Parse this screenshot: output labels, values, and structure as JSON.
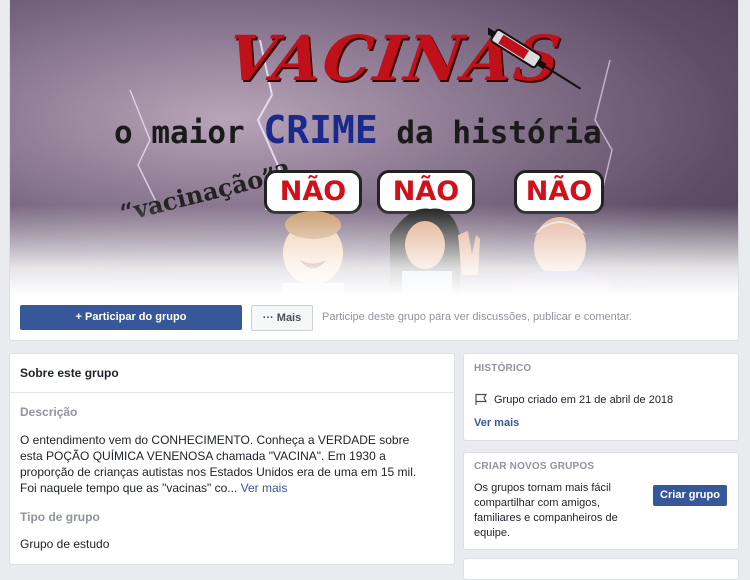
{
  "cover": {
    "title": "VACINAS",
    "subtitle_pre": "o maior ",
    "subtitle_crime": "CRIME",
    "subtitle_post": " da história",
    "tagline": "“vacinação”?",
    "bubbles": [
      "NÃO",
      "NÃO",
      "NÃO"
    ]
  },
  "actions": {
    "join_label": "Participar do grupo",
    "more_label": "Mais",
    "hint": "Participe deste grupo para ver discussões, publicar e comentar."
  },
  "about": {
    "title": "Sobre este grupo",
    "description_label": "Descrição",
    "description": "O entendimento vem do CONHECIMENTO. Conheça a VERDADE sobre esta POÇÃO QUÍMICA VENENOSA chamada \"VACINA\". Em 1930 a proporção de crianças autistas nos Estados Unidos era de uma em 15 mil. Foi naquele tempo que as \"vacinas\" co...",
    "see_more": "Ver mais",
    "type_label": "Tipo de grupo",
    "type_value": "Grupo de estudo"
  },
  "history": {
    "title": "HISTÓRICO",
    "created": "Grupo criado em 21 de abril de 2018",
    "see_more": "Ver mais"
  },
  "create_groups": {
    "title": "CRIAR NOVOS GRUPOS",
    "text": "Os grupos tornam mais fácil compartilhar com amigos, familiares e companheiros de equipe.",
    "button": "Criar grupo"
  },
  "colors": {
    "primary": "#365899",
    "accent_red": "#c0101a",
    "page_bg": "#e9ebee"
  }
}
